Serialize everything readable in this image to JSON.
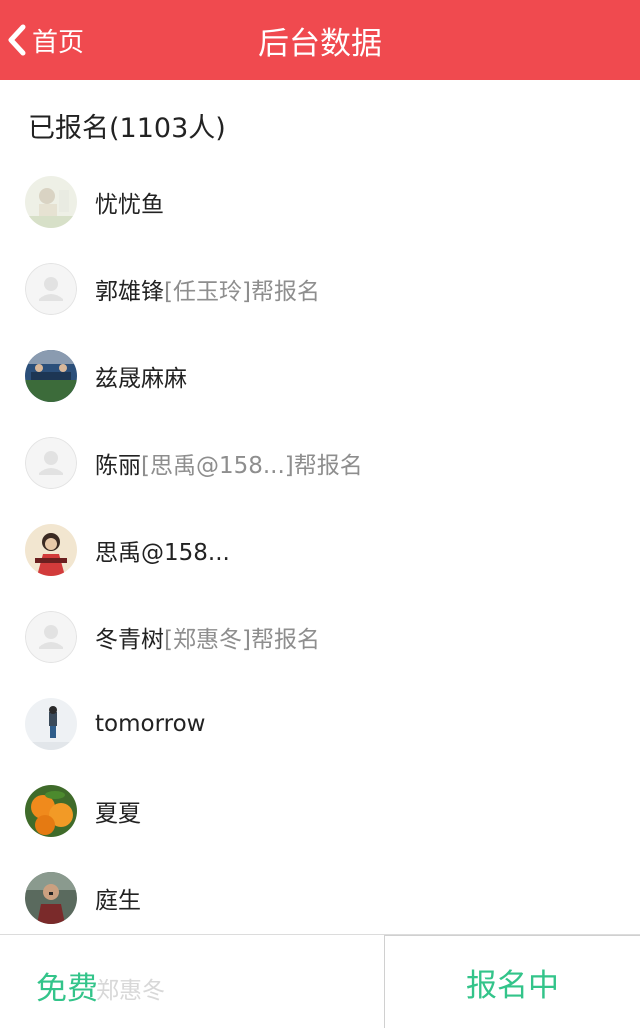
{
  "header": {
    "back_label": "首页",
    "title": "后台数据",
    "background_color": "#f04a4f"
  },
  "registered_heading": "已报名(1103人)",
  "registrants": [
    {
      "name": "忧忧鱼",
      "helper": "",
      "avatar": "photo-avatar-light"
    },
    {
      "name": "郭雄锋",
      "helper": "[任玉玲]帮报名",
      "avatar": "default-user-icon"
    },
    {
      "name": "兹晟麻麻",
      "helper": "",
      "avatar": "photo-avatar-team"
    },
    {
      "name": "陈丽",
      "helper": "[思禹@158...]帮报名",
      "avatar": "default-user-icon"
    },
    {
      "name": "思禹@158...",
      "helper": "",
      "avatar": "photo-avatar-portrait"
    },
    {
      "name": "冬青树",
      "helper": "[郑惠冬]帮报名",
      "avatar": "default-user-icon"
    },
    {
      "name": "tomorrow",
      "helper": "",
      "avatar": "photo-avatar-figure"
    },
    {
      "name": "夏夏",
      "helper": "",
      "avatar": "photo-avatar-oranges"
    },
    {
      "name": "庭生",
      "helper": "",
      "avatar": "photo-avatar-man"
    }
  ],
  "bottom_bar": {
    "price_label": "免费",
    "obscured_name": "郑惠冬",
    "status_button": "报名中",
    "accent_color": "#33c48a"
  }
}
